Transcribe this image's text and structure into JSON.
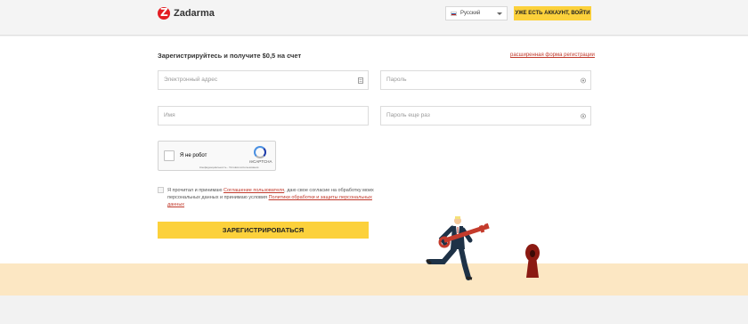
{
  "header": {
    "logo_text": "Zadarma",
    "language": "Русский",
    "login_label": "УЖЕ ЕСТЬ АККАУНТ, ВОЙТИ"
  },
  "form": {
    "title": "Зарегистрируйтесь и получите $0,5 на счет",
    "extended_link": "расширенная форма регистрации",
    "email_placeholder": "Электронный адрес",
    "password_placeholder": "Пароль",
    "name_placeholder": "Имя",
    "password_repeat_placeholder": "Пароль еще раз",
    "register_label": "ЗАРЕГИСТРИРОВАТЬСЯ"
  },
  "captcha": {
    "label": "Я не робот",
    "brand": "reCAPTCHA",
    "terms": "Конфиденциальность - Условия использования"
  },
  "consent": {
    "text_1": "Я прочитал и принимаю ",
    "link_1": "Соглашение пользователя",
    "text_2": ", даю свое согласие на обработку моих персональных данных и принимаю условия ",
    "link_2": "Политики обработки и защиты персональных данных"
  },
  "colors": {
    "accent": "#fcd13b",
    "link": "#c0392b",
    "brand_red": "#e31e24",
    "ground": "#fce7c3"
  }
}
